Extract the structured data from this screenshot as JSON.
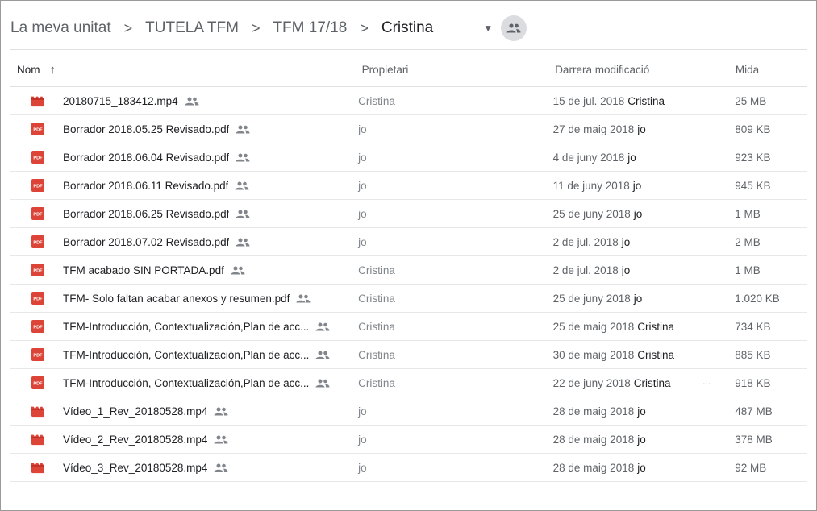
{
  "breadcrumb": {
    "items": [
      "La meva unitat",
      "TUTELA TFM",
      "TFM 17/18",
      "Cristina"
    ],
    "separator": ">",
    "dropdown_icon": "caret-down-icon",
    "share_icon": "people-icon"
  },
  "table": {
    "headers": {
      "name": "Nom",
      "owner": "Propietari",
      "modified": "Darrera modificació",
      "size": "Mida"
    },
    "sort_icon": "arrow-up-icon",
    "rows": [
      {
        "type": "video",
        "name": "20180715_183412.mp4",
        "owner": "Cristina",
        "date": "15 de jul. 2018",
        "by": "Cristina",
        "size": "25 MB"
      },
      {
        "type": "pdf",
        "name": "Borrador 2018.05.25 Revisado.pdf",
        "owner": "jo",
        "date": "27 de maig 2018",
        "by": "jo",
        "size": "809 KB"
      },
      {
        "type": "pdf",
        "name": "Borrador 2018.06.04 Revisado.pdf",
        "owner": "jo",
        "date": "4 de juny 2018",
        "by": "jo",
        "size": "923 KB"
      },
      {
        "type": "pdf",
        "name": "Borrador 2018.06.11 Revisado.pdf",
        "owner": "jo",
        "date": "11 de juny 2018",
        "by": "jo",
        "size": "945 KB"
      },
      {
        "type": "pdf",
        "name": "Borrador 2018.06.25 Revisado.pdf",
        "owner": "jo",
        "date": "25 de juny 2018",
        "by": "jo",
        "size": "1 MB"
      },
      {
        "type": "pdf",
        "name": "Borrador 2018.07.02 Revisado.pdf",
        "owner": "jo",
        "date": "2 de jul. 2018",
        "by": "jo",
        "size": "2 MB"
      },
      {
        "type": "pdf",
        "name": "TFM acabado SIN PORTADA.pdf",
        "owner": "Cristina",
        "date": "2 de jul. 2018",
        "by": "jo",
        "size": "1 MB"
      },
      {
        "type": "pdf",
        "name": "TFM- Solo faltan acabar anexos y resumen.pdf",
        "owner": "Cristina",
        "date": "25 de juny 2018",
        "by": "jo",
        "size": "1.020 KB"
      },
      {
        "type": "pdf",
        "name": "TFM-Introducción, Contextualización,Plan de acc...",
        "owner": "Cristina",
        "date": "25 de maig 2018",
        "by": "Cristina",
        "size": "734 KB"
      },
      {
        "type": "pdf",
        "name": "TFM-Introducción, Contextualización,Plan de acc...",
        "owner": "Cristina",
        "date": "30 de maig 2018",
        "by": "Cristina",
        "size": "885 KB"
      },
      {
        "type": "pdf",
        "name": "TFM-Introducción, Contextualización,Plan de acc...",
        "owner": "Cristina",
        "date": "22 de juny 2018",
        "by": "Cristina",
        "size": "918 KB",
        "extra": "..."
      },
      {
        "type": "video",
        "name": "Vídeo_1_Rev_20180528.mp4",
        "owner": "jo",
        "date": "28 de maig 2018",
        "by": "jo",
        "size": "487 MB"
      },
      {
        "type": "video",
        "name": "Vídeo_2_Rev_20180528.mp4",
        "owner": "jo",
        "date": "28 de maig 2018",
        "by": "jo",
        "size": "378 MB"
      },
      {
        "type": "video",
        "name": "Vídeo_3_Rev_20180528.mp4",
        "owner": "jo",
        "date": "28 de maig 2018",
        "by": "jo",
        "size": "92 MB"
      }
    ]
  },
  "icons": {
    "pdf_label": "PDF",
    "pdf_icon": "pdf-file-icon",
    "video_icon": "video-file-icon",
    "shared_icon": "shared-people-icon"
  },
  "colors": {
    "file_icon_red": "#db4437",
    "text_primary": "#202124",
    "text_secondary": "#5f6368"
  }
}
